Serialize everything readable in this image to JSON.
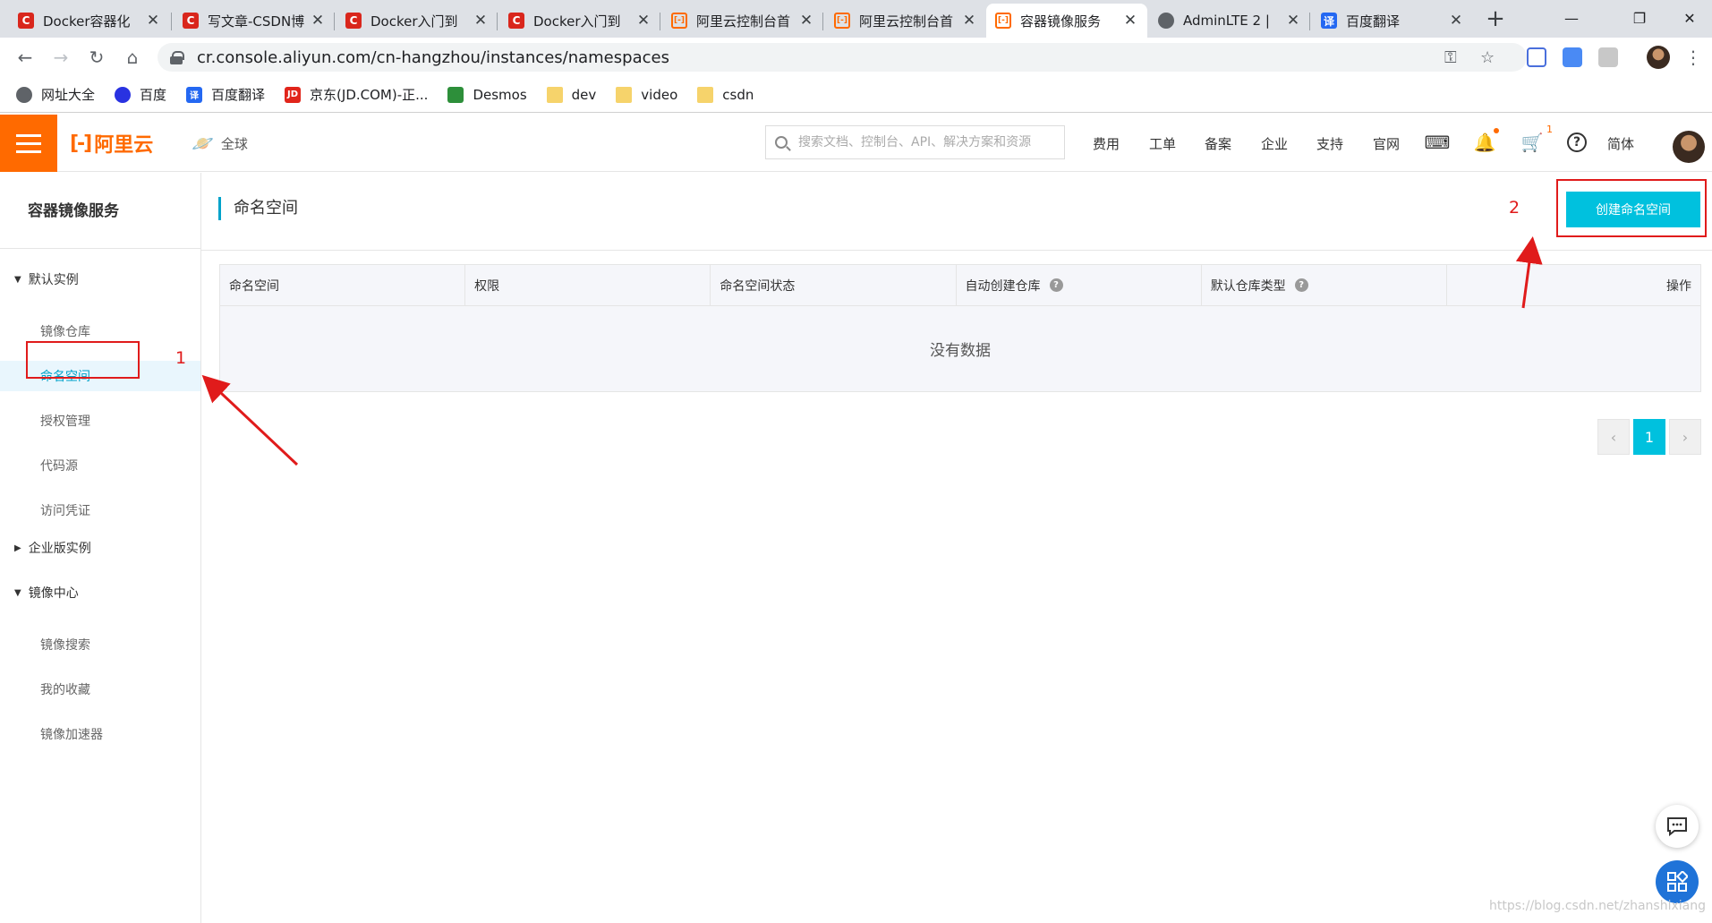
{
  "browser": {
    "tabs": [
      {
        "title": "Docker容器化",
        "icon": "csdn-icon",
        "active": false
      },
      {
        "title": "写文章-CSDN博",
        "icon": "csdn-icon",
        "active": false
      },
      {
        "title": "Docker入门到",
        "icon": "csdn-icon",
        "active": false
      },
      {
        "title": "Docker入门到",
        "icon": "csdn-icon",
        "active": false
      },
      {
        "title": "阿里云控制台首",
        "icon": "aliyun-icon",
        "active": false
      },
      {
        "title": "阿里云控制台首",
        "icon": "aliyun-icon",
        "active": false
      },
      {
        "title": "容器镜像服务",
        "icon": "aliyun-icon",
        "active": true
      },
      {
        "title": "AdminLTE 2 | ",
        "icon": "globe-icon",
        "active": false
      },
      {
        "title": "百度翻译",
        "icon": "translate-icon",
        "active": false
      }
    ],
    "url": "cr.console.aliyun.com/cn-hangzhou/instances/namespaces",
    "bookmarks": [
      "网址大全",
      "百度",
      "百度翻译",
      "京东(JD.COM)-正...",
      "Desmos",
      "dev",
      "video",
      "csdn"
    ]
  },
  "console": {
    "brand": "阿里云",
    "region": "全球",
    "search_placeholder": "搜索文档、控制台、API、解决方案和资源",
    "nav_links": [
      "费用",
      "工单",
      "备案",
      "企业",
      "支持",
      "官网"
    ],
    "cart_count": "1",
    "language": "简体"
  },
  "sidebar": {
    "title": "容器镜像服务",
    "groups": [
      {
        "label": "默认实例",
        "expanded": true,
        "items": [
          "镜像仓库",
          "命名空间",
          "授权管理",
          "代码源",
          "访问凭证"
        ]
      },
      {
        "label": "企业版实例",
        "expanded": false,
        "items": []
      },
      {
        "label": "镜像中心",
        "expanded": true,
        "items": [
          "镜像搜索",
          "我的收藏",
          "镜像加速器"
        ]
      }
    ],
    "active_item": "命名空间"
  },
  "main": {
    "title": "命名空间",
    "create_button": "创建命名空间",
    "columns": [
      "命名空间",
      "权限",
      "命名空间状态",
      "自动创建仓库",
      "默认仓库类型",
      "操作"
    ],
    "empty_text": "没有数据",
    "pagination": {
      "current": "1"
    }
  },
  "annotations": {
    "step1": "1",
    "step2": "2",
    "color": "#e01b1b"
  },
  "watermark": "https://blog.csdn.net/zhanshixiang"
}
